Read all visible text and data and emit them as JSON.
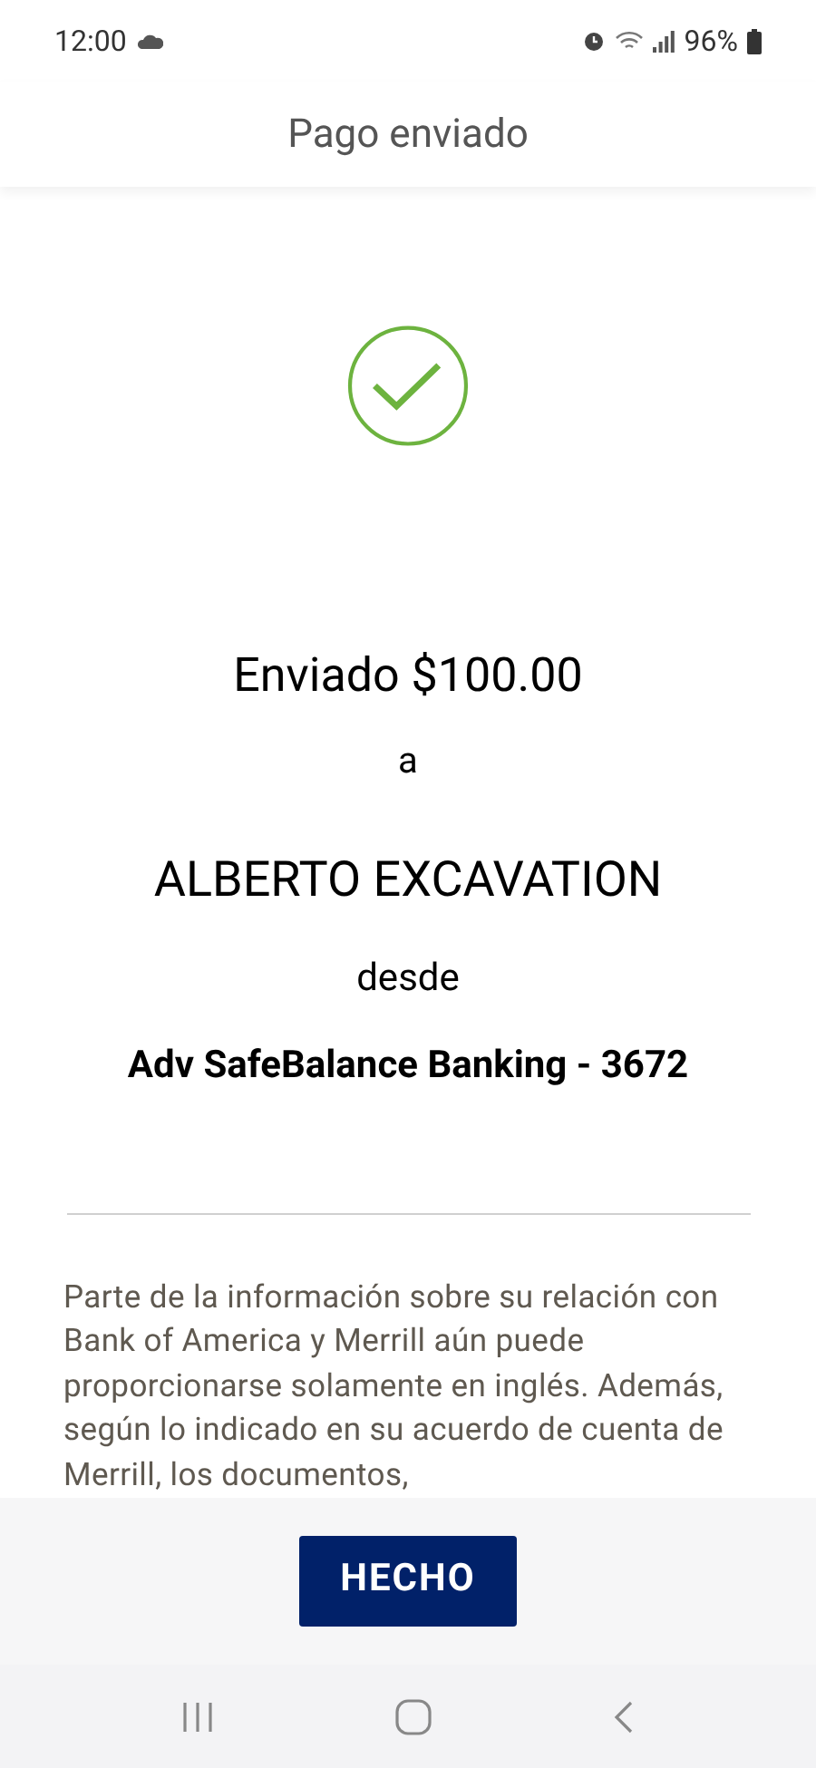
{
  "status_bar": {
    "time": "12:00",
    "battery": "96%"
  },
  "header": {
    "title": "Pago enviado"
  },
  "confirmation": {
    "amount_line": "Enviado $100.00",
    "connector_to": "a",
    "recipient": "ALBERTO EXCAVATION",
    "connector_from": "desde",
    "account": "Adv SafeBalance Banking - 3672"
  },
  "disclosure": [
    "Parte de la información sobre su relación con Bank of America y Merrill aún puede proporcionarse solamente en inglés. Además, según lo indicado en su acuerdo de cuenta de Merrill, los documentos,"
  ],
  "buttons": [
    {
      "label": "HECHO",
      "kind": "primary"
    }
  ]
}
